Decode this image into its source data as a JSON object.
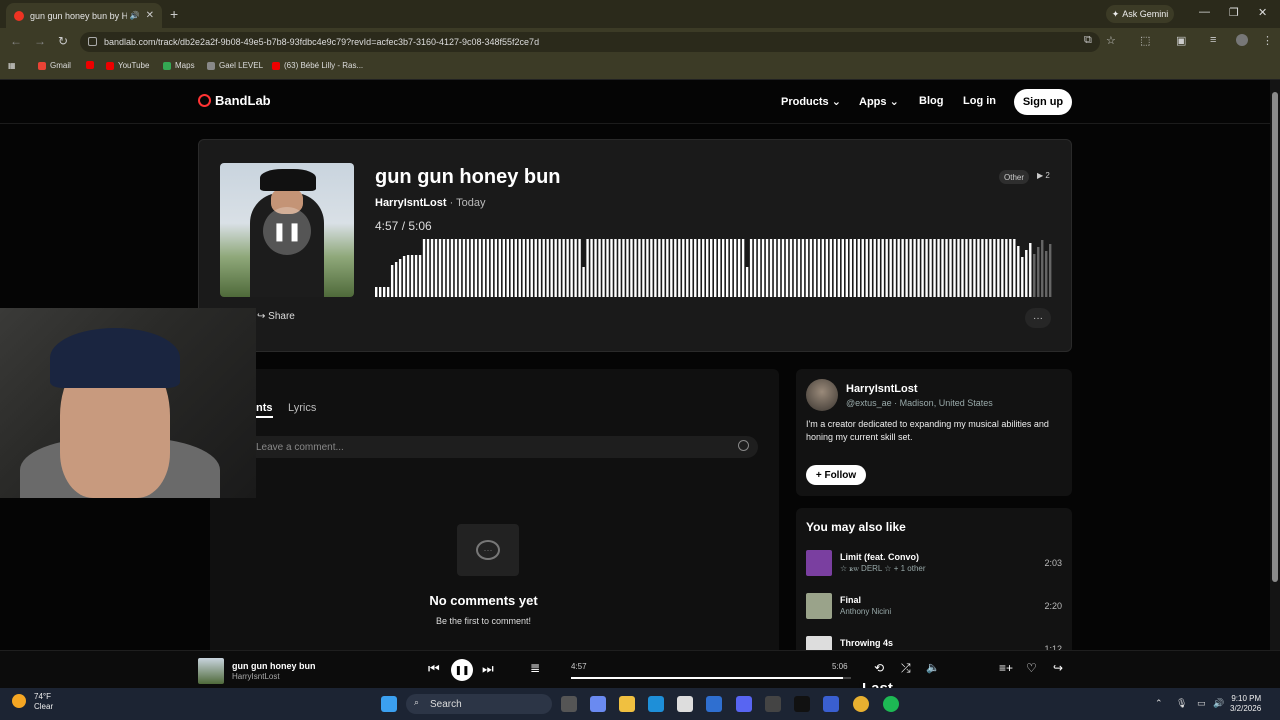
{
  "browser": {
    "tab_title": "gun gun honey bun by Harr",
    "ask_gemini": "Ask Gemini",
    "url": "bandlab.com/track/db2e2a2f-9b08-49e5-b7b8-93fdbc4e9c79?revId=acfec3b7-3160-4127-9c08-348f55f2ce7d",
    "bookmarks": [
      "Gmail",
      "YouTube",
      "Maps",
      "Gael LEVEL",
      "(63) Bébé Lilly - Ras..."
    ]
  },
  "site": {
    "logo": "BandLab",
    "nav": {
      "products": "Products",
      "apps": "Apps",
      "blog": "Blog",
      "login": "Log in",
      "signup": "Sign up"
    }
  },
  "track": {
    "title": "gun gun honey bun",
    "artist": "HarryIsntLost",
    "date": "· Today",
    "current_time": "4:57",
    "duration": "5:06",
    "time_sep": " / ",
    "tag": "Other",
    "plays": "2",
    "share": "Share",
    "progress_fraction": 0.97
  },
  "comments": {
    "tab_comments": "nts",
    "tab_lyrics": "Lyrics",
    "placeholder": "Leave a comment...",
    "empty_title": "No comments yet",
    "empty_sub": "Be the first to comment!"
  },
  "profile": {
    "name": "HarryIsntLost",
    "handle": "@extus_ae",
    "location": "Madison, United States",
    "bio": "I'm a creator dedicated to expanding my musical abilities and honing my current skill set.",
    "follow": "Follow"
  },
  "also_like": {
    "title": "You may also like",
    "items": [
      {
        "name": "Limit (feat. Convo)",
        "sub": "☆ ꭱꮃ DERL ☆ + 1 other",
        "duration": "2:03",
        "color": "#7a3fa0"
      },
      {
        "name": "Final",
        "sub": "Anthony Nicini",
        "duration": "2:20",
        "color": "#9aa38a"
      },
      {
        "name": "Throwing 4s",
        "sub": "",
        "duration": "1:12",
        "color": "#dddddd"
      }
    ]
  },
  "player": {
    "title": "gun gun honey bun",
    "artist": "HarryIsntLost",
    "current": "4:57",
    "duration": "5:06",
    "progress_fraction": 0.97
  },
  "overlay": {
    "last": "Last"
  },
  "taskbar": {
    "temp": "74°F",
    "weather": "Clear",
    "search": "Search",
    "time": "9:10 PM",
    "date": "3/2/2026"
  }
}
